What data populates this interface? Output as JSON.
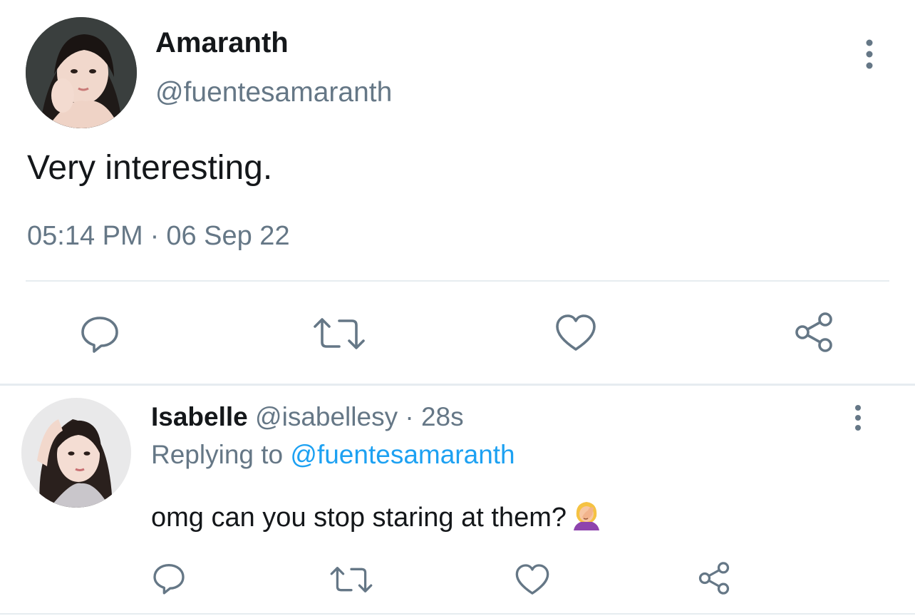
{
  "main_tweet": {
    "display_name": "Amaranth",
    "handle": "@fuentesamaranth",
    "text": "Very interesting.",
    "time": "05:14 PM",
    "separator": "·",
    "date": "06 Sep 22",
    "icons": [
      "reply-icon",
      "retweet-icon",
      "like-icon",
      "share-icon",
      "more-icon"
    ]
  },
  "reply": {
    "display_name": "Isabelle",
    "handle": "@isabellesy",
    "separator": "·",
    "age": "28s",
    "replying_prefix": "Replying to",
    "replying_handle": "@fuentesamaranth",
    "text": "omg can you stop staring at them?",
    "emoji_name": "woman-facepalming",
    "icons": [
      "reply-icon",
      "retweet-icon",
      "like-icon",
      "share-icon",
      "more-icon"
    ]
  },
  "colors": {
    "text": "#14171a",
    "secondary": "#657786",
    "link": "#1da1f2",
    "icon": "#657786",
    "divider": "#e6ecf0"
  }
}
